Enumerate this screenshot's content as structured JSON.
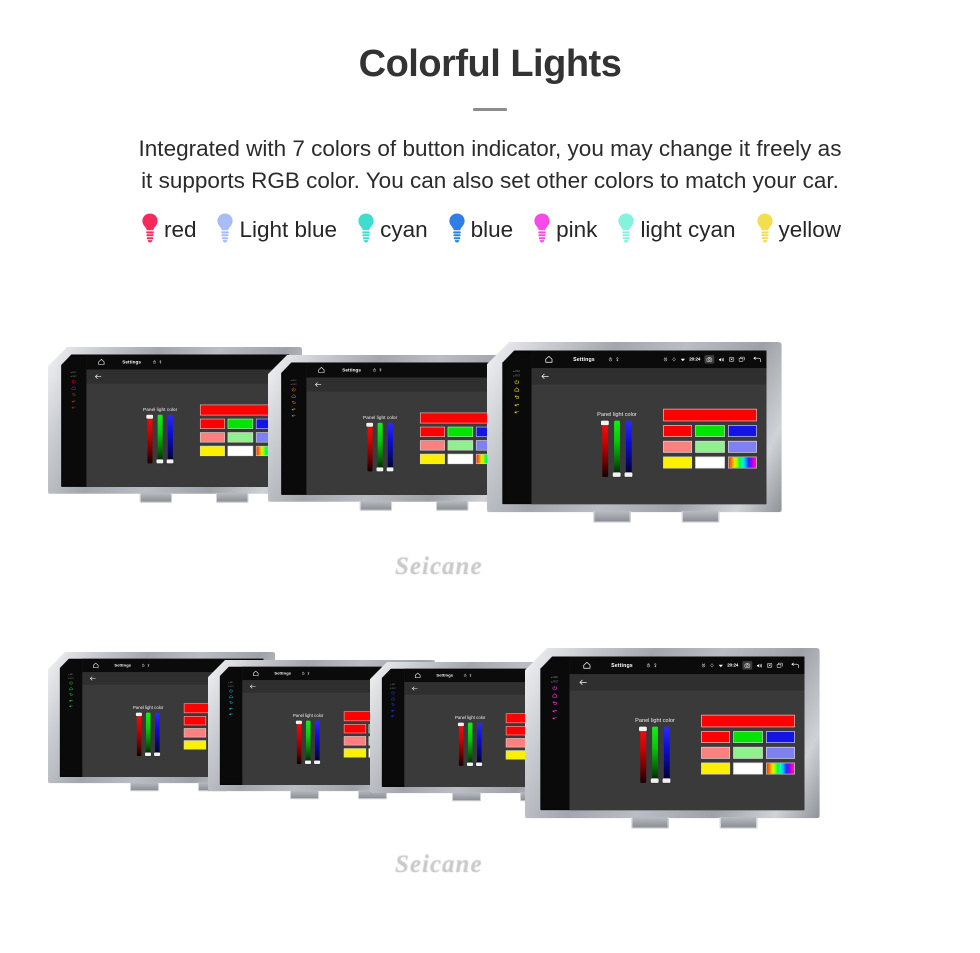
{
  "header": {
    "title": "Colorful Lights",
    "subtitle_line1": "Integrated with 7 colors of button indicator, you may change it freely as",
    "subtitle_line2": "it supports RGB color. You can also set other colors to match your car."
  },
  "legend": {
    "items": [
      {
        "label": "red",
        "icon": "bulb-icon",
        "color": "#f72a5e"
      },
      {
        "label": "Light blue",
        "icon": "bulb-icon",
        "color": "#a8bcf7"
      },
      {
        "label": "cyan",
        "icon": "bulb-icon",
        "color": "#3fdcd0"
      },
      {
        "label": "blue",
        "icon": "bulb-icon",
        "color": "#2e7de8"
      },
      {
        "label": "pink",
        "icon": "bulb-icon",
        "color": "#f84ae8"
      },
      {
        "label": "light cyan",
        "icon": "bulb-icon",
        "color": "#84f2dd"
      },
      {
        "label": "yellow",
        "icon": "bulb-icon",
        "color": "#f2de4e"
      }
    ]
  },
  "device_ui": {
    "statusbar": {
      "home_icon": "home-icon",
      "title": "Settings",
      "timer_icon": "timer-icon",
      "location_icon": "location-pin-icon",
      "alarm_icon": "alarm-icon",
      "gps_icon": "gps-icon",
      "wifi_icon": "wifi-icon",
      "clock": "20:24",
      "camera_icon": "camera-icon",
      "volume_icon": "volume-icon",
      "close_icon": "close-box-icon",
      "recents_icon": "recents-icon",
      "back_icon": "back-arrow-icon"
    },
    "subbar": {
      "back_icon": "back-arrow-icon"
    },
    "panel": {
      "label": "Panel light color",
      "sliders": [
        {
          "name": "red-slider",
          "position": "max"
        },
        {
          "name": "green-slider",
          "position": "min"
        },
        {
          "name": "blue-slider",
          "position": "min"
        }
      ],
      "preview_color": "#fe0000",
      "swatch_rows": [
        [
          {
            "name": "swatch-red",
            "color": "#fe0000"
          },
          {
            "name": "swatch-green",
            "color": "#00e400"
          },
          {
            "name": "swatch-blue",
            "color": "#1414e8"
          }
        ],
        [
          {
            "name": "swatch-salmon",
            "color": "#fb8080"
          },
          {
            "name": "swatch-lightgreen",
            "color": "#90f08f"
          },
          {
            "name": "swatch-periwinkle",
            "color": "#8080f5"
          }
        ],
        [
          {
            "name": "swatch-yellow",
            "color": "#fcf000"
          },
          {
            "name": "swatch-white",
            "color": "#ffffff"
          },
          {
            "name": "swatch-rainbow",
            "color": "rainbow"
          }
        ]
      ]
    },
    "hardware_buttons": {
      "mic_label": "MIC",
      "rst_label": "RST",
      "icons": [
        "power-icon",
        "home-icon",
        "back-icon",
        "volume-up-icon",
        "volume-down-icon"
      ]
    }
  },
  "units": {
    "top_row": [
      {
        "name": "head-unit-red",
        "led_color": "#e01b1b",
        "detail": "partial"
      },
      {
        "name": "head-unit-orange",
        "led_color": "#e08a12",
        "detail": "partial"
      },
      {
        "name": "head-unit-yellow",
        "led_color": "#e8d21b",
        "detail": "full"
      }
    ],
    "bottom_row": [
      {
        "name": "head-unit-green",
        "led_color": "#27d83f",
        "detail": "partial"
      },
      {
        "name": "head-unit-cyan",
        "led_color": "#16d6d6",
        "detail": "partial"
      },
      {
        "name": "head-unit-blue",
        "led_color": "#2b3ef0",
        "detail": "partial"
      },
      {
        "name": "head-unit-magenta",
        "led_color": "#ee3bd6",
        "detail": "full"
      }
    ]
  },
  "watermark": {
    "text": "Seicane"
  }
}
